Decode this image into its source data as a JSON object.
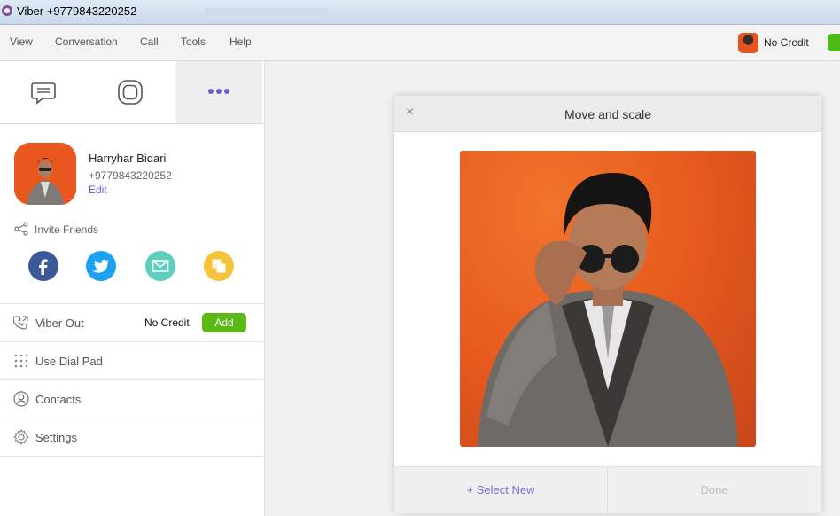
{
  "window": {
    "title": "Viber +9779843220252"
  },
  "menu": [
    "View",
    "Conversation",
    "Call",
    "Tools",
    "Help"
  ],
  "credit": {
    "label": "No Credit"
  },
  "tabs": [
    {
      "name": "chats",
      "icon": "chat-bubble-icon"
    },
    {
      "name": "public-chats",
      "icon": "public-chats-icon"
    },
    {
      "name": "more",
      "icon": "more-dots-icon",
      "active": true
    }
  ],
  "profile": {
    "name": "Harryhar Bidari",
    "phone": "+9779843220252",
    "edit": "Edit"
  },
  "invite": {
    "label": "Invite Friends",
    "channels": [
      "facebook-icon",
      "twitter-icon",
      "email-icon",
      "copy-icon"
    ]
  },
  "rows": {
    "viber_out": {
      "label": "Viber Out",
      "credit": "No Credit",
      "add": "Add"
    },
    "dial_pad": {
      "label": "Use Dial Pad"
    },
    "contacts": {
      "label": "Contacts"
    },
    "settings": {
      "label": "Settings"
    }
  },
  "dialog": {
    "title": "Move and scale",
    "close": "×",
    "select_new": "+ Select New",
    "done": "Done"
  },
  "colors": {
    "accent": "#7b6bd3",
    "green": "#5bb815",
    "photo_bg": "#e65a1e"
  }
}
